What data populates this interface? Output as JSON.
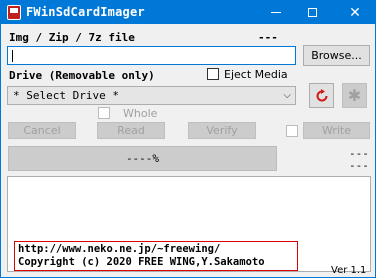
{
  "window": {
    "title": "FWinSdCardImager",
    "icon": "sd-card-icon",
    "minimize_glyph": "minimize-icon",
    "maximize_glyph": "maximize-icon",
    "close_glyph": "✕"
  },
  "image_file": {
    "label": "Img / Zip / 7z file",
    "size_text": "---",
    "value": "",
    "browse_label": "Browse..."
  },
  "drive": {
    "label": "Drive (Removable only)",
    "eject_media_label": "Eject Media",
    "eject_media_checked": false,
    "selected": "* Select Drive *",
    "refresh_icon": "refresh-icon",
    "settings_icon": "asterisk-icon",
    "whole_label": "Whole",
    "whole_checked": false
  },
  "actions": {
    "cancel": "Cancel",
    "read": "Read",
    "verify": "Verify",
    "write": "Write",
    "write_checked": false
  },
  "progress": {
    "text": "----%",
    "percent": 0,
    "status_line1": "---",
    "status_line2": "---"
  },
  "log": {
    "line1": "http://www.neko.ne.jp/~freewing/",
    "line2": "Copyright (c) 2020 FREE WING,Y.Sakamoto"
  },
  "version": "Ver 1.1",
  "colors": {
    "titlebar": "#0078d7",
    "focus_border": "#0078d7",
    "refresh_icon": "#d01818",
    "copyright_border": "#e00000"
  }
}
